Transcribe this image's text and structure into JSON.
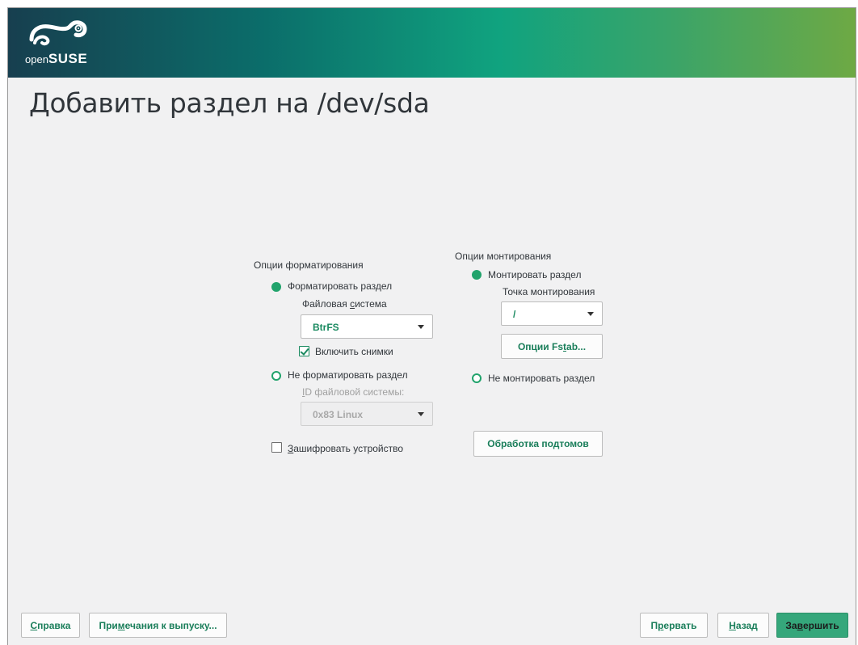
{
  "window": {
    "brand": {
      "prefix": "open",
      "suffix": "SUSE"
    },
    "title": "Добавить раздел на /dev/sda"
  },
  "format_options": {
    "heading": "Опции форматирования",
    "format_radio": {
      "label": "Форматировать раздел",
      "selected": true
    },
    "filesystem_label": "Файловая система",
    "filesystem_value": "BtrFS",
    "snapshots": {
      "label": "Включить снимки",
      "checked": true
    },
    "noformat_radio": {
      "label": "Не форматировать раздел",
      "selected": false
    },
    "fs_id_label": "ID файловой системы:",
    "fs_id_value": "0x83 Linux",
    "encrypt": {
      "label": "Зашифровать устройство",
      "checked": false
    }
  },
  "mount_options": {
    "heading": "Опции монтирования",
    "mount_radio": {
      "label": "Монтировать раздел",
      "selected": true
    },
    "mountpoint_label": "Точка монтирования",
    "mountpoint_value": "/",
    "fstab_button": "Опции Fstab...",
    "nomount_radio": {
      "label": "Не монтировать раздел",
      "selected": false
    },
    "subvolumes_button": "Обработка подтомов"
  },
  "footer": {
    "help": "Справка",
    "release_notes": "Примечания к выпуску...",
    "abort": "Прервать",
    "back": "Назад",
    "finish": "Завершить"
  },
  "colors": {
    "accent": "#21a36c",
    "banner_start": "#173f4f",
    "banner_end": "#6ea944"
  }
}
